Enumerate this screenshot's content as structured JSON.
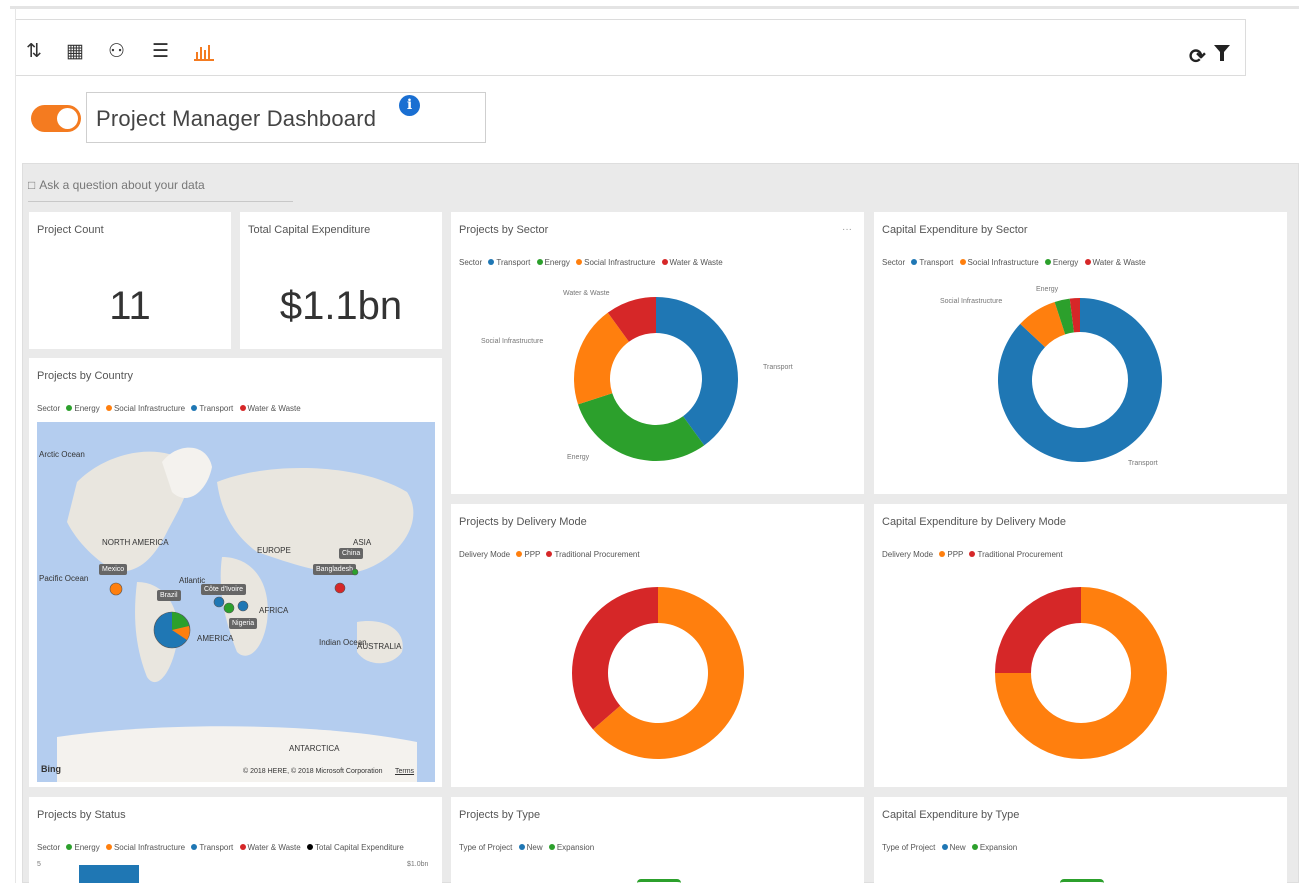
{
  "toolbar": {
    "icons": [
      "sort-az-icon",
      "calendar-icon",
      "users-icon",
      "list-icon",
      "bar-chart-icon"
    ],
    "right_icons": [
      "refresh-icon",
      "filter-icon"
    ],
    "active_color": "#f47b20"
  },
  "header": {
    "title": "Project Manager Dashboard",
    "info": "i"
  },
  "qa": {
    "placeholder": "Ask a question about your data"
  },
  "colors": {
    "transport": "#1f77b4",
    "energy": "#2ca02c",
    "social": "#ff7f0e",
    "water": "#d62728",
    "capex": "#000000"
  },
  "tiles": {
    "project_count": {
      "title": "Project Count",
      "value": "11"
    },
    "total_capex": {
      "title": "Total Capital Expenditure",
      "value": "$1.1bn"
    },
    "projects_by_country": {
      "title": "Projects by Country",
      "legend_title": "Sector",
      "legend": [
        "Energy",
        "Social Infrastructure",
        "Transport",
        "Water & Waste"
      ],
      "labels": {
        "arctic": "Arctic Ocean",
        "north_america": "NORTH AMERICA",
        "europe": "EUROPE",
        "asia": "ASIA",
        "pacific": "Pacific Ocean",
        "atlantic": "Atlantic",
        "africa": "AFRICA",
        "south_america": "AMERICA",
        "indian": "Indian Ocean",
        "australia": "AUSTRALIA",
        "antarctica": "ANTARCTICA"
      },
      "tags": {
        "mexico": "Mexico",
        "brazil": "Brazil",
        "cote": "Côte d'Ivoire",
        "nigeria": "Nigeria",
        "china": "China",
        "bangladesh": "Bangladesh"
      },
      "bing": "Bing",
      "copyright": "© 2018 HERE, © 2018 Microsoft Corporation",
      "terms": "Terms"
    },
    "projects_by_sector": {
      "title": "Projects by Sector",
      "legend_title": "Sector",
      "legend": [
        "Transport",
        "Energy",
        "Social Infrastructure",
        "Water & Waste"
      ],
      "labels": [
        "Transport",
        "Energy",
        "Social Infrastructure",
        "Water & Waste"
      ],
      "more": "···"
    },
    "capex_by_sector": {
      "title": "Capital Expenditure by Sector",
      "legend_title": "Sector",
      "legend": [
        "Transport",
        "Social Infrastructure",
        "Energy",
        "Water & Waste"
      ],
      "labels": [
        "Transport",
        "Social Infrastructure",
        "Energy"
      ]
    },
    "projects_by_delivery": {
      "title": "Projects by Delivery Mode",
      "legend_title": "Delivery Mode",
      "legend": [
        "PPP",
        "Traditional Procurement"
      ]
    },
    "capex_by_delivery": {
      "title": "Capital Expenditure by Delivery Mode",
      "legend_title": "Delivery Mode",
      "legend": [
        "PPP",
        "Traditional Procurement"
      ]
    },
    "projects_by_status": {
      "title": "Projects by Status",
      "legend_title": "Sector",
      "legend": [
        "Energy",
        "Social Infrastructure",
        "Transport",
        "Water & Waste",
        "Total Capital Expenditure"
      ],
      "y_left": "5",
      "y_right": "$1.0bn"
    },
    "projects_by_type": {
      "title": "Projects by Type",
      "legend_title": "Type of Project",
      "legend": [
        "New",
        "Expansion"
      ]
    },
    "capex_by_type": {
      "title": "Capital Expenditure by Type",
      "legend_title": "Type of Project",
      "legend": [
        "New",
        "Expansion"
      ]
    }
  },
  "chart_data": [
    {
      "type": "pie",
      "title": "Projects by Sector",
      "labels": [
        "Transport",
        "Energy",
        "Social Infrastructure",
        "Water & Waste"
      ],
      "values": [
        4,
        3,
        2,
        1
      ],
      "colors": [
        "#1f77b4",
        "#2ca02c",
        "#ff7f0e",
        "#d62728"
      ]
    },
    {
      "type": "pie",
      "title": "Capital Expenditure by Sector",
      "labels": [
        "Transport",
        "Social Infrastructure",
        "Energy",
        "Water & Waste"
      ],
      "values": [
        0.87,
        0.08,
        0.03,
        0.02
      ],
      "colors": [
        "#1f77b4",
        "#ff7f0e",
        "#2ca02c",
        "#d62728"
      ]
    },
    {
      "type": "pie",
      "title": "Projects by Delivery Mode",
      "labels": [
        "PPP",
        "Traditional Procurement"
      ],
      "values": [
        7,
        4
      ],
      "colors": [
        "#ff7f0e",
        "#d62728"
      ]
    },
    {
      "type": "pie",
      "title": "Capital Expenditure by Delivery Mode",
      "labels": [
        "PPP",
        "Traditional Procurement"
      ],
      "values": [
        0.75,
        0.25
      ],
      "colors": [
        "#ff7f0e",
        "#d62728"
      ]
    }
  ]
}
